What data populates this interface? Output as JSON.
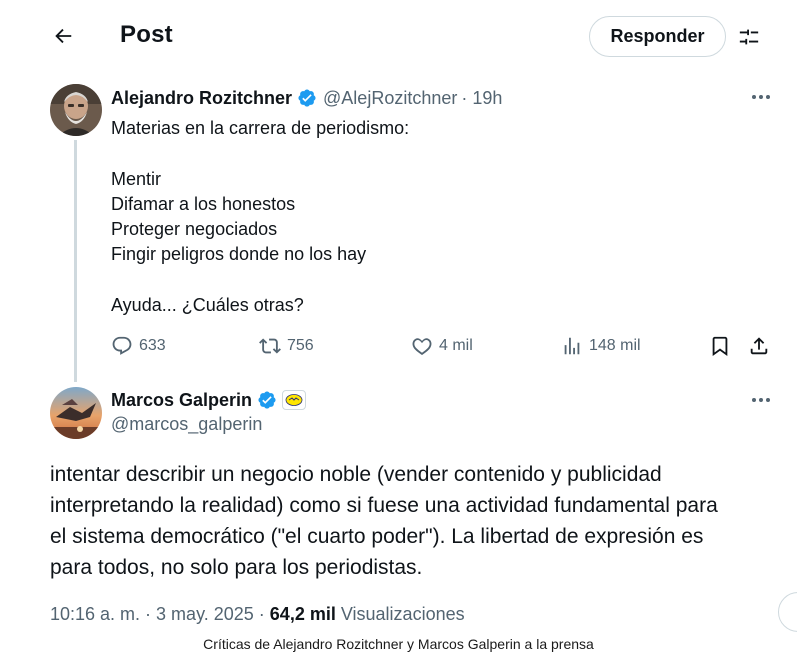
{
  "header": {
    "title": "Post",
    "reply_label": "Responder",
    "back_icon": "arrow-left-icon",
    "settings_icon": "sliders-icon"
  },
  "quoted_post": {
    "author_name": "Alejandro Rozitchner",
    "handle": "@AlejRozitchner",
    "time": "· 19h",
    "verified": true,
    "text_lines": [
      "Materias en la carrera de periodismo:",
      "",
      "Mentir",
      "Difamar a los honestos",
      "Proteger negociados",
      "Fingir peligros donde no los hay",
      "",
      "Ayuda... ¿Cuáles otras?"
    ],
    "stats": {
      "replies": "633",
      "reposts": "756",
      "likes": "4 mil",
      "views": "148 mil"
    }
  },
  "main_post": {
    "author_name": "Marcos Galperin",
    "handle": "@marcos_galperin",
    "verified": true,
    "affiliate_badge_icon": "mercadolibre-handshake-icon",
    "text_lines": [
      "intentar describir un negocio noble (vender contenido y publicidad",
      "interpretando la realidad) como si fuese una actividad fundamental para",
      "el sistema democrático (\"el cuarto poder\"). La libertad de expresión es",
      "para todos, no solo para los periodistas."
    ],
    "timestamp": "10:16 a. m. · 3 may. 2025 ·",
    "views_count": "64,2 mil",
    "views_label": "Visualizaciones"
  },
  "caption": "Críticas de Alejandro Rozitchner y Marcos Galperin a la prensa",
  "colors": {
    "text": "#0f1419",
    "secondary": "#536471",
    "verified_blue": "#1d9bf0",
    "border": "#cfd9de"
  }
}
